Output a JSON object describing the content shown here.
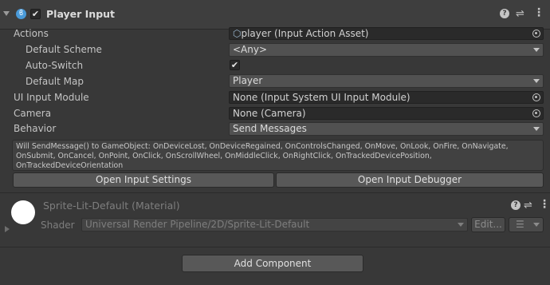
{
  "component": {
    "title": "Player Input",
    "enabled_check": "✔",
    "icons": [
      "player-input-icon",
      "help-icon",
      "preset-icon",
      "context-menu-icon"
    ]
  },
  "fields": {
    "actions": {
      "label": "Actions",
      "value": "player (Input Action Asset)"
    },
    "default_scheme": {
      "label": "Default Scheme",
      "value": "<Any>"
    },
    "auto_switch": {
      "label": "Auto-Switch",
      "checked": "✔"
    },
    "default_map": {
      "label": "Default Map",
      "value": "Player"
    },
    "ui_input_module": {
      "label": "UI Input Module",
      "value": "None (Input System UI Input Module)"
    },
    "camera": {
      "label": "Camera",
      "value": "None (Camera)"
    },
    "behavior": {
      "label": "Behavior",
      "value": "Send Messages"
    }
  },
  "help_text": "Will SendMessage() to GameObject: OnDeviceLost, OnDeviceRegained, OnControlsChanged, OnMove, OnLook, OnFire, OnNavigate, OnSubmit, OnCancel, OnPoint, OnClick, OnScrollWheel, OnMiddleClick, OnRightClick, OnTrackedDevicePosition, OnTrackedDeviceOrientation",
  "buttons": {
    "open_settings": "Open Input Settings",
    "open_debugger": "Open Input Debugger",
    "add_component": "Add Component"
  },
  "material": {
    "name": "Sprite-Lit-Default (Material)",
    "shader_label": "Shader",
    "shader_value": "Universal Render Pipeline/2D/Sprite-Lit-Default",
    "edit_label": "Edit..."
  },
  "colors": {
    "background": "#383838",
    "header": "#3e3e3e",
    "field": "#2a2a2a",
    "dropdown": "#515151"
  }
}
